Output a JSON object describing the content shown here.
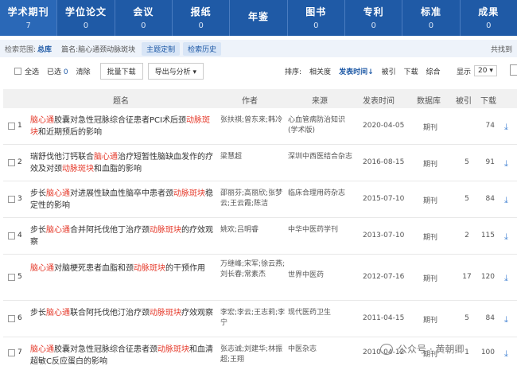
{
  "tabs": [
    {
      "label": "学术期刊",
      "count": "7",
      "active": true
    },
    {
      "label": "学位论文",
      "count": "0"
    },
    {
      "label": "会议",
      "count": "0"
    },
    {
      "label": "报纸",
      "count": "0"
    },
    {
      "label": "年鉴",
      "count": ""
    },
    {
      "label": "图书",
      "count": "0"
    },
    {
      "label": "专利",
      "count": "0"
    },
    {
      "label": "标准",
      "count": "0"
    },
    {
      "label": "成果",
      "count": "0"
    }
  ],
  "scope": {
    "label": "检索范围:",
    "total": "总库",
    "query": "篇名:脑心通颈动脉斑块",
    "theme_btn": "主题定制",
    "history_btn": "检索历史",
    "found": "共找到"
  },
  "toolbar": {
    "select_all": "全选",
    "selected_label": "已选",
    "selected_count": "0",
    "clear": "清除",
    "batch_download": "批量下载",
    "export": "导出与分析 ▾",
    "sort_label": "排序:",
    "sort_options": [
      "相关度",
      "发表时间↓",
      "被引",
      "下载",
      "综合"
    ],
    "display_label": "显示",
    "display_value": "20 ▾"
  },
  "headers": {
    "title": "题名",
    "author": "作者",
    "source": "来源",
    "date": "发表时间",
    "db": "数据库",
    "cite": "被引",
    "download": "下载"
  },
  "rows": [
    {
      "num": "1",
      "title": [
        {
          "t": "脑心通",
          "h": true
        },
        {
          "t": "胶囊对急性冠脉综合征患者PCI术后颈"
        },
        {
          "t": "动脉斑块",
          "h": true
        },
        {
          "t": "和近期预后的影响"
        }
      ],
      "author": "张扶祺;曾东来;韩冷",
      "source": "心血管病防治知识(学术版)",
      "date": "2020-04-05",
      "db": "期刊",
      "cite": "",
      "download": "74"
    },
    {
      "num": "2",
      "title": [
        {
          "t": "瑞舒伐他汀钙联合"
        },
        {
          "t": "脑心通",
          "h": true
        },
        {
          "t": "治疗短暂性脑缺血发作的疗效及对颈"
        },
        {
          "t": "动脉斑块",
          "h": true
        },
        {
          "t": "和血脂的影响"
        }
      ],
      "author": "梁慧超",
      "source": "深圳中西医结合杂志",
      "date": "2016-08-15",
      "db": "期刊",
      "cite": "5",
      "download": "91"
    },
    {
      "num": "3",
      "title": [
        {
          "t": "步长"
        },
        {
          "t": "脑心通",
          "h": true
        },
        {
          "t": "对进展性缺血性脑卒中患者颈"
        },
        {
          "t": "动脉斑块",
          "h": true
        },
        {
          "t": "稳定性的影响"
        }
      ],
      "author": "邵丽芬;高丽欣;张梦云;王云霞;陈洁",
      "source": "临床合理用药杂志",
      "date": "2015-07-10",
      "db": "期刊",
      "cite": "5",
      "download": "84"
    },
    {
      "num": "4",
      "title": [
        {
          "t": "步长"
        },
        {
          "t": "脑心通",
          "h": true
        },
        {
          "t": "合并阿托伐他丁治疗颈"
        },
        {
          "t": "动脉斑块",
          "h": true
        },
        {
          "t": "的疗效观察"
        }
      ],
      "author": "姚欢;吕明睿",
      "source": "中华中医药学刊",
      "date": "2013-07-10",
      "db": "期刊",
      "cite": "2",
      "download": "115"
    },
    {
      "num": "5",
      "title": [
        {
          "t": "脑心通",
          "h": true
        },
        {
          "t": "对脑梗死患者血脂和颈"
        },
        {
          "t": "动脉斑块",
          "h": true
        },
        {
          "t": "的干预作用"
        }
      ],
      "author": "万继峰;宋军;徐云燕;刘长春;常素杰",
      "source": "世界中医药",
      "date": "2012-07-16",
      "db": "期刊",
      "cite": "17",
      "download": "120"
    },
    {
      "num": "6",
      "title": [
        {
          "t": "步长"
        },
        {
          "t": "脑心通",
          "h": true
        },
        {
          "t": "联合阿托伐他汀治疗颈"
        },
        {
          "t": "动脉斑块",
          "h": true
        },
        {
          "t": "疗效观察"
        }
      ],
      "author": "李宏;李云;王志莉;李宁",
      "source": "现代医药卫生",
      "date": "2011-04-15",
      "db": "期刊",
      "cite": "5",
      "download": "84"
    },
    {
      "num": "7",
      "title": [
        {
          "t": "脑心通",
          "h": true
        },
        {
          "t": "胶囊对急性冠脉综合征患者颈"
        },
        {
          "t": "动脉斑块",
          "h": true
        },
        {
          "t": "和血清超敏C反应蛋白的影响"
        }
      ],
      "author": "张志诚;刘建华;林振超;王翔",
      "source": "中医杂志",
      "date": "2010-04-12",
      "db": "期刊",
      "cite": "1",
      "download": "100"
    }
  ],
  "watermark": "公众号 · 黄朝卿",
  "colors": {
    "tabbar": "#1f5aa6",
    "highlight": "#e53b2c",
    "link": "#1f5aa6"
  }
}
